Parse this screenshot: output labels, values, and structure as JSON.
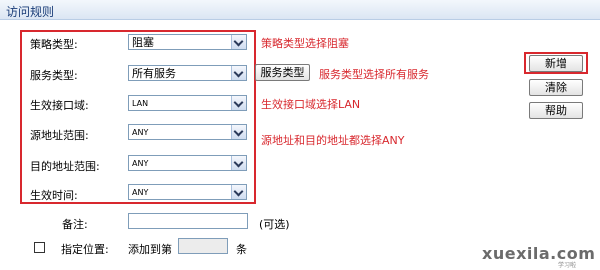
{
  "header": {
    "title": "访问规则"
  },
  "form": {
    "policy_type": {
      "label": "策略类型:",
      "value": "阻塞",
      "annotation": "策略类型选择阻塞"
    },
    "service_type": {
      "label": "服务类型:",
      "value": "所有服务",
      "button": "服务类型",
      "annotation": "服务类型选择所有服务"
    },
    "interface": {
      "label": "生效接口域:",
      "value": "LAN",
      "annotation": "生效接口域选择LAN"
    },
    "src_range": {
      "label": "源地址范围:",
      "value": "ANY"
    },
    "dst_range": {
      "label": "目的地址范围:",
      "value": "ANY"
    },
    "time": {
      "label": "生效时间:",
      "value": "ANY"
    },
    "address_annotation": "源地址和目的地址都选择ANY",
    "remark": {
      "label": "备注:",
      "value": "",
      "hint": "(可选)"
    },
    "position": {
      "checkbox_label": "指定位置:",
      "prefix": "添加到第",
      "value": "",
      "suffix": "条"
    }
  },
  "actions": {
    "add": "新增",
    "clear": "清除",
    "help": "帮助"
  },
  "watermark": {
    "text": "xuexila.com",
    "sub": "学习啦"
  },
  "colors": {
    "annotation": "#d8282e",
    "header_text": "#1a3d78"
  }
}
